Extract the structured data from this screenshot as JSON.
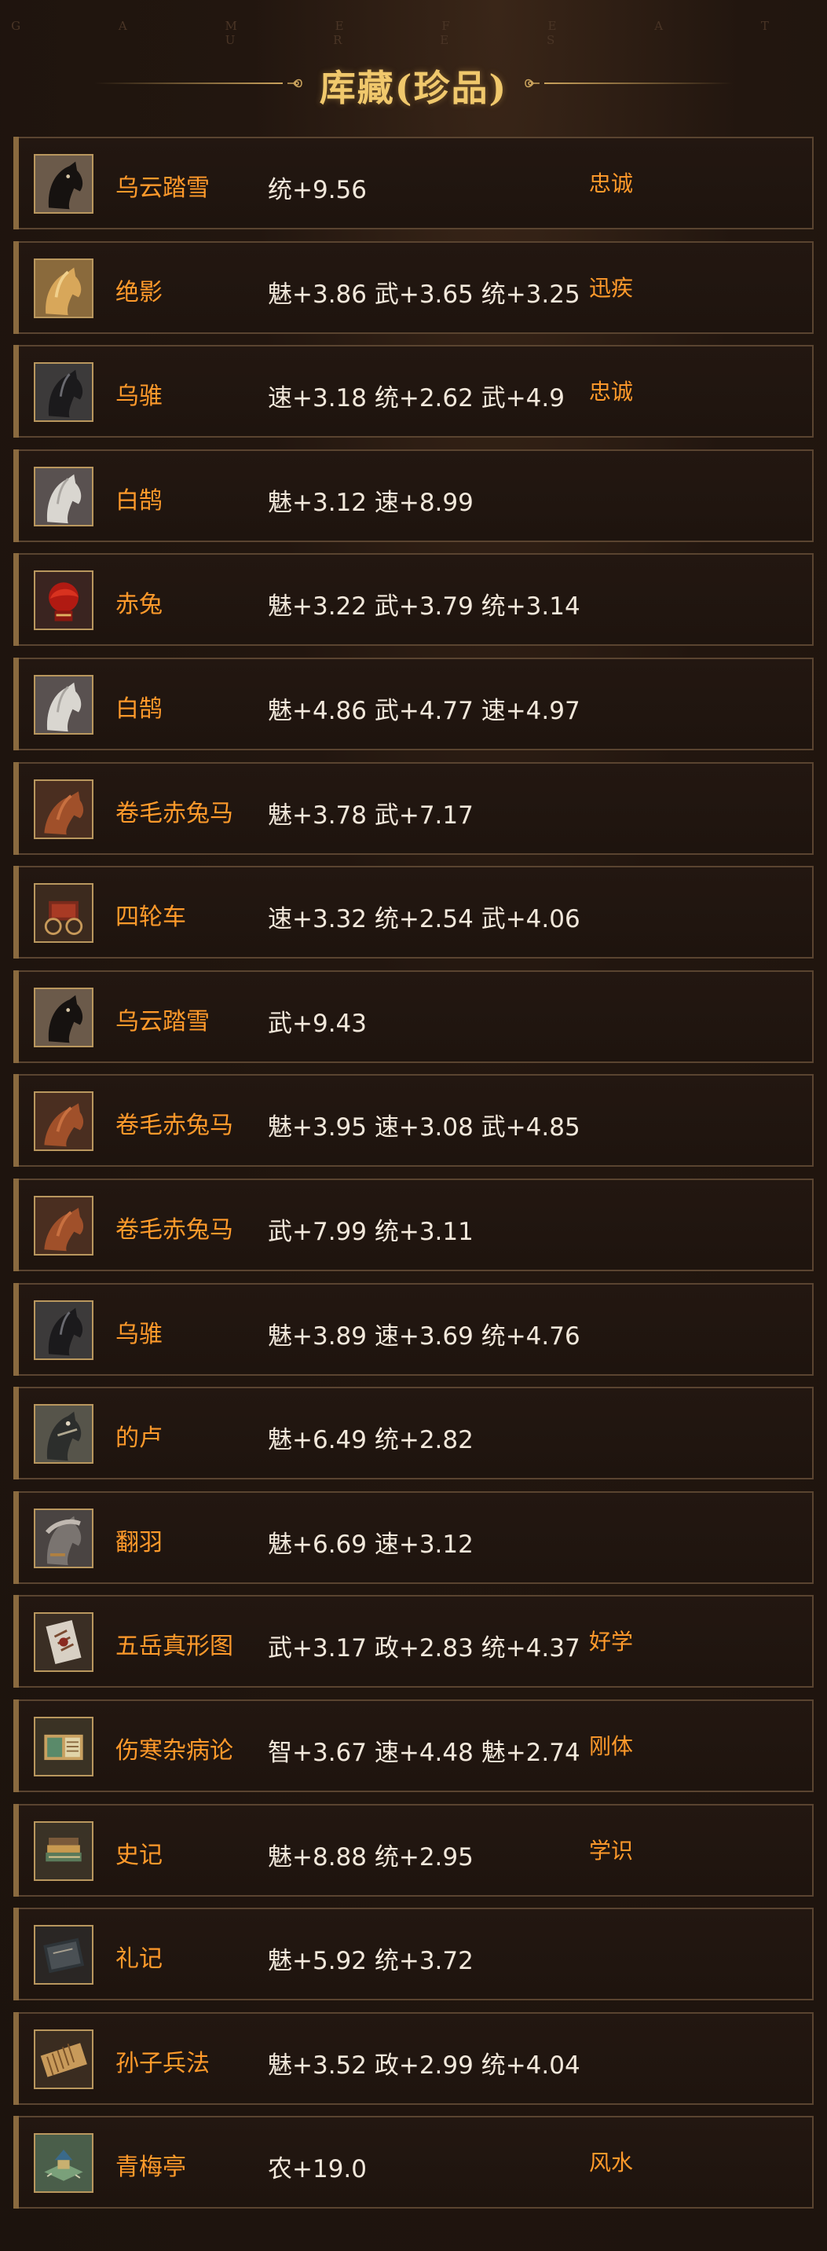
{
  "header": {
    "subtitle": "G A M E   F E A T U R E S",
    "title": "库藏(珍品)"
  },
  "colors": {
    "name": "#ff9a2b",
    "stats": "#f2e8db",
    "title": "#f0c86c",
    "border": "#5a4430"
  },
  "items": [
    {
      "name": "乌云踏雪",
      "stats": "统+9.56",
      "trait": "忠诚",
      "icon": "black-horse-icon"
    },
    {
      "name": "绝影",
      "stats": "魅+3.86 武+3.65 统+3.25",
      "trait": "迅疾",
      "icon": "golden-horse-icon"
    },
    {
      "name": "乌骓",
      "stats": "速+3.18 统+2.62 武+4.9",
      "trait": "忠诚",
      "icon": "dark-horse-icon"
    },
    {
      "name": "白鹄",
      "stats": "魅+3.12 速+8.99",
      "trait": "",
      "icon": "white-horse-icon"
    },
    {
      "name": "赤兔",
      "stats": "魅+3.22 武+3.79 统+3.14",
      "trait": "",
      "icon": "red-horse-icon"
    },
    {
      "name": "白鹄",
      "stats": "魅+4.86 武+4.77 速+4.97",
      "trait": "",
      "icon": "white-horse-icon"
    },
    {
      "name": "卷毛赤兔马",
      "stats": "魅+3.78 武+7.17",
      "trait": "",
      "icon": "brown-horse-icon"
    },
    {
      "name": "四轮车",
      "stats": "速+3.32 统+2.54 武+4.06",
      "trait": "",
      "icon": "cart-icon"
    },
    {
      "name": "乌云踏雪",
      "stats": "武+9.43",
      "trait": "",
      "icon": "black-horse-icon"
    },
    {
      "name": "卷毛赤兔马",
      "stats": "魅+3.95 速+3.08 武+4.85",
      "trait": "",
      "icon": "brown-horse-icon"
    },
    {
      "name": "卷毛赤兔马",
      "stats": "武+7.99 统+3.11",
      "trait": "",
      "icon": "brown-horse-icon"
    },
    {
      "name": "乌骓",
      "stats": "魅+3.89 速+3.69 统+4.76",
      "trait": "",
      "icon": "dark-horse-icon"
    },
    {
      "name": "的卢",
      "stats": "魅+6.49 统+2.82",
      "trait": "",
      "icon": "gray-horse-icon"
    },
    {
      "name": "翻羽",
      "stats": "魅+6.69 速+3.12",
      "trait": "",
      "icon": "armored-horse-icon"
    },
    {
      "name": "五岳真形图",
      "stats": "武+3.17 政+2.83 统+4.37",
      "trait": "好学",
      "icon": "scroll-map-icon"
    },
    {
      "name": "伤寒杂病论",
      "stats": "智+3.67 速+4.48 魅+2.74",
      "trait": "刚体",
      "icon": "book-icon"
    },
    {
      "name": "史记",
      "stats": "魅+8.88 统+2.95",
      "trait": "学识",
      "icon": "book-stack-icon"
    },
    {
      "name": "礼记",
      "stats": "魅+5.92 统+3.72",
      "trait": "",
      "icon": "dark-book-icon"
    },
    {
      "name": "孙子兵法",
      "stats": "魅+3.52 政+2.99 统+4.04",
      "trait": "",
      "icon": "bamboo-scroll-icon"
    },
    {
      "name": "青梅亭",
      "stats": "农+19.0",
      "trait": "风水",
      "icon": "pavilion-icon"
    }
  ]
}
